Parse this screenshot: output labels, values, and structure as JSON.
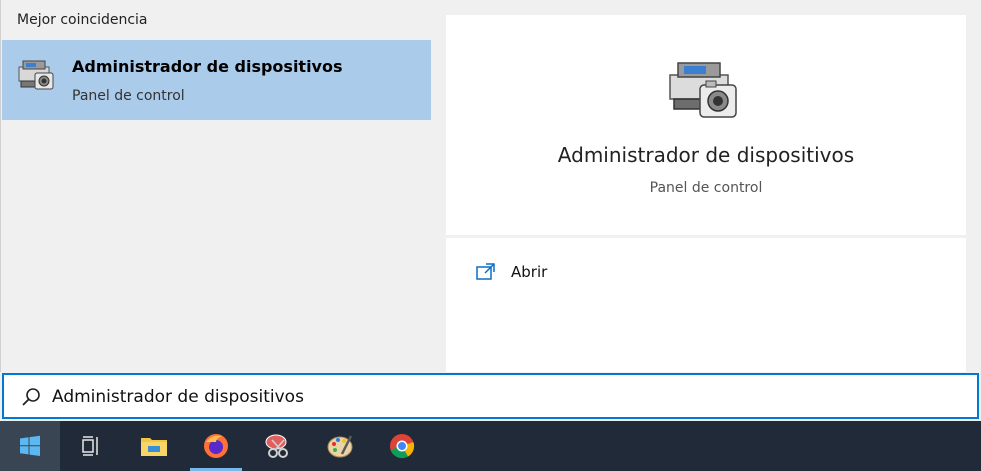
{
  "left": {
    "section_title": "Mejor coincidencia",
    "best_match": {
      "title": "Administrador de dispositivos",
      "subtitle": "Panel de control",
      "icon": "device-manager-icon"
    }
  },
  "detail": {
    "title": "Administrador de dispositivos",
    "subtitle": "Panel de control",
    "icon": "device-manager-icon",
    "actions": [
      {
        "label": "Abrir",
        "icon": "open-icon"
      }
    ]
  },
  "search": {
    "value": "Administrador de dispositivos",
    "icon": "search-icon"
  },
  "taskbar": {
    "items": [
      {
        "name": "start",
        "icon": "windows-logo-icon"
      },
      {
        "name": "task-view",
        "icon": "task-view-icon"
      },
      {
        "name": "file-explorer",
        "icon": "folder-icon"
      },
      {
        "name": "firefox",
        "icon": "firefox-icon"
      },
      {
        "name": "snipping-tool",
        "icon": "snipping-tool-icon"
      },
      {
        "name": "paint",
        "icon": "paint-icon"
      },
      {
        "name": "chrome",
        "icon": "chrome-icon"
      }
    ],
    "accent": "#76b9ed",
    "background": "#202a38"
  },
  "colors": {
    "selection": "#aacbea",
    "search_border": "#0078d4",
    "panel": "#f0f0f0"
  }
}
